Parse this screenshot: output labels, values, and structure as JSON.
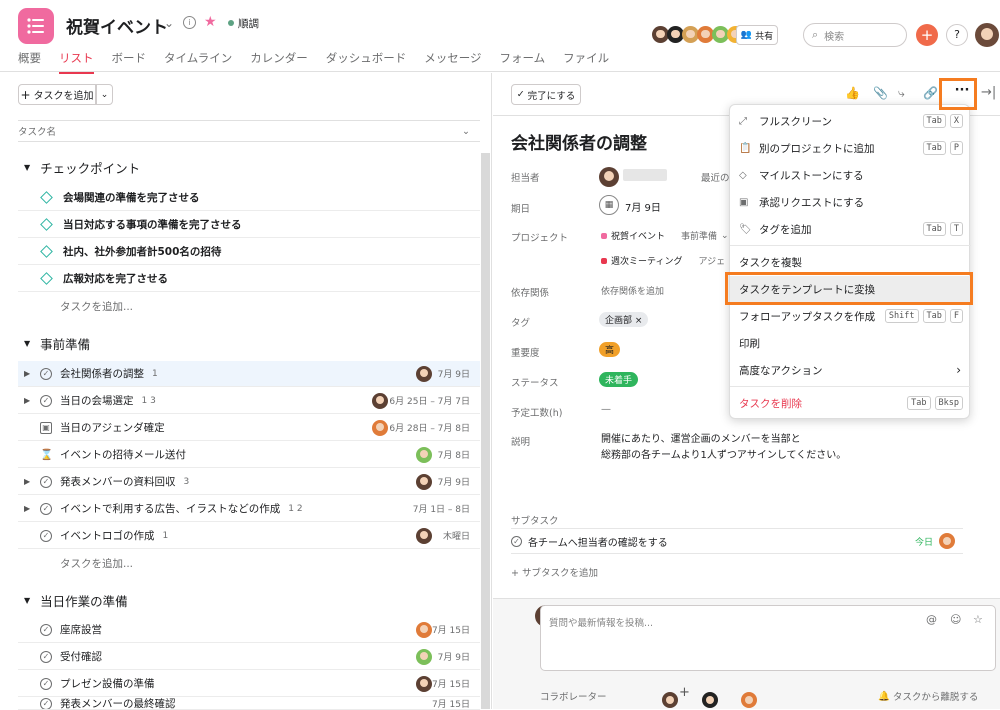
{
  "header": {
    "title": "祝賀イベント",
    "status": "順調",
    "share": "共有",
    "search_placeholder": "検索",
    "help": "?"
  },
  "tabs": [
    "概要",
    "リスト",
    "ボード",
    "タイムライン",
    "カレンダー",
    "ダッシュボード",
    "メッセージ",
    "フォーム",
    "ファイル"
  ],
  "list": {
    "add_task": "タスクを追加",
    "column_header": "タスク名",
    "add_task_inline": "タスクを追加...",
    "sections": [
      {
        "name": "チェックポイント",
        "tasks": [
          {
            "name": "会場関連の準備を完了させる"
          },
          {
            "name": "当日対応する事項の準備を完了させる"
          },
          {
            "name": "社内、社外参加者計500名の招待"
          },
          {
            "name": "広報対応を完了させる"
          }
        ]
      },
      {
        "name": "事前準備",
        "tasks": [
          {
            "name": "会社関係者の調整",
            "meta": "1",
            "date": "7月 9日"
          },
          {
            "name": "当日の会場選定",
            "meta": "1  3",
            "date": "6月 25日 – 7月 7日"
          },
          {
            "name": "当日のアジェンダ確定",
            "meta": "",
            "date": "6月 28日 – 7月 8日"
          },
          {
            "name": "イベントの招待メール送付",
            "meta": "",
            "date": "7月 8日"
          },
          {
            "name": "発表メンバーの資料回収",
            "meta": "3",
            "date": "7月 9日"
          },
          {
            "name": "イベントで利用する広告、イラストなどの作成",
            "meta": "1  2",
            "date": "7月 1日 – 8日"
          },
          {
            "name": "イベントロゴの作成",
            "meta": "1",
            "date": "木曜日"
          }
        ]
      },
      {
        "name": "当日作業の準備",
        "tasks": [
          {
            "name": "座席設営",
            "date": "7月 15日"
          },
          {
            "name": "受付確認",
            "date": "7月 9日"
          },
          {
            "name": "プレゼン設備の準備",
            "date": "7月 15日"
          },
          {
            "name": "発表メンバーの最終確認",
            "date": "7月 15日"
          }
        ]
      }
    ]
  },
  "detail": {
    "complete_button": "完了にする",
    "title": "会社関係者の調整",
    "labels": {
      "assignee": "担当者",
      "due": "期日",
      "project": "プロジェクト",
      "dependency": "依存関係",
      "tag": "タグ",
      "priority": "重要度",
      "status": "ステータス",
      "estimate": "予定工数(h)",
      "description": "説明",
      "subtasks": "サブタスク"
    },
    "assignee_extra": "最近の",
    "due_value": "7月 9日",
    "project1": "祝賀イベント",
    "project1_section": "事前準備",
    "project2": "週次ミーティング",
    "project2_section": "アジェ",
    "dependency_value": "依存関係を追加",
    "tag_value": "企画部",
    "priority_value": "高",
    "status_value": "未着手",
    "estimate_value": "—",
    "description_text": "開催にあたり、運営企画のメンバーを当部と\n総務部の各チームより1人ずつアサインしてください。",
    "subtask": "各チームへ担当者の確認をする",
    "subtask_due": "今日",
    "add_subtask": "サブタスクを追加",
    "comment_placeholder": "質問や最新情報を投稿...",
    "collaborators": "コラボレーター",
    "leave": "タスクから離脱する"
  },
  "menu": {
    "items": [
      {
        "label": "フルスクリーン",
        "keys": [
          "Tab",
          "X"
        ],
        "icon": "expand-icon"
      },
      {
        "label": "別のプロジェクトに追加",
        "keys": [
          "Tab",
          "P"
        ],
        "icon": "clipboard-icon"
      },
      {
        "label": "マイルストーンにする",
        "keys": [],
        "icon": "diamond-icon"
      },
      {
        "label": "承認リクエストにする",
        "keys": [],
        "icon": "approval-icon"
      },
      {
        "label": "タグを追加",
        "keys": [
          "Tab",
          "T"
        ],
        "icon": "tag-icon"
      },
      {
        "label": "タスクを複製",
        "keys": []
      },
      {
        "label": "タスクをテンプレートに変換",
        "keys": []
      },
      {
        "label": "フォローアップタスクを作成",
        "keys": [
          "Shift",
          "Tab",
          "F"
        ]
      },
      {
        "label": "印刷",
        "keys": []
      },
      {
        "label": "高度なアクション",
        "keys": []
      },
      {
        "label": "タスクを削除",
        "keys": [
          "Tab",
          "Bksp"
        ]
      }
    ]
  },
  "colors": {
    "accent": "#e8384f",
    "highlight": "#f57c20",
    "menu_delete": "#e8384f"
  }
}
